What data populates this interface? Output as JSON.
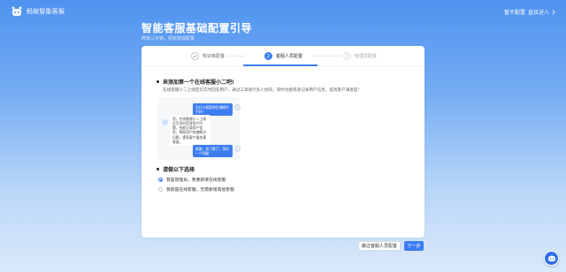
{
  "brand": {
    "name": "蚂蚁智能客服",
    "logo_icon": "robot-logo-icon"
  },
  "top_right": {
    "label_1": "暂不配置",
    "label_2": "直接进入",
    "icon": "chevron-right-icon"
  },
  "page": {
    "title": "智能客服基础配置引导",
    "subtitle": "简单三分钟，轻松完成配置"
  },
  "steps": [
    {
      "label": "知识库配置",
      "state": "done",
      "icon": "check-icon"
    },
    {
      "label": "客服人员配置",
      "state": "active",
      "number": "2"
    },
    {
      "label": "管理员配置",
      "state": "todo",
      "number": "3"
    }
  ],
  "section1": {
    "title": "来添加第一个在线客服小二吧!",
    "desc": "在线客服小二上线后可实时回答用户，通过工单进行多人协同，同时也能快速记录用户信息，提高客户满意度!"
  },
  "chat": {
    "q1": "为什么我家的空调制冷不好?",
    "a1": "您，在线客服小二上线后可实时回答用户问题，也能记录用户信息，帮助用户快速解决问题，提高客户服务满意度。",
    "q2": "谢谢，知了解了，再问一个问题"
  },
  "section2": {
    "title": "请做以下选择",
    "options": [
      {
        "label": "我是管理员，我要新增在线客服",
        "checked": true
      },
      {
        "label": "我就是在线客服，无需新增其他客服",
        "checked": false
      }
    ]
  },
  "buttons": {
    "skip": "跳过客服人员配置",
    "next": "下一步"
  },
  "colors": {
    "primary": "#3d7df2",
    "bg_top": "#4f93f0"
  }
}
